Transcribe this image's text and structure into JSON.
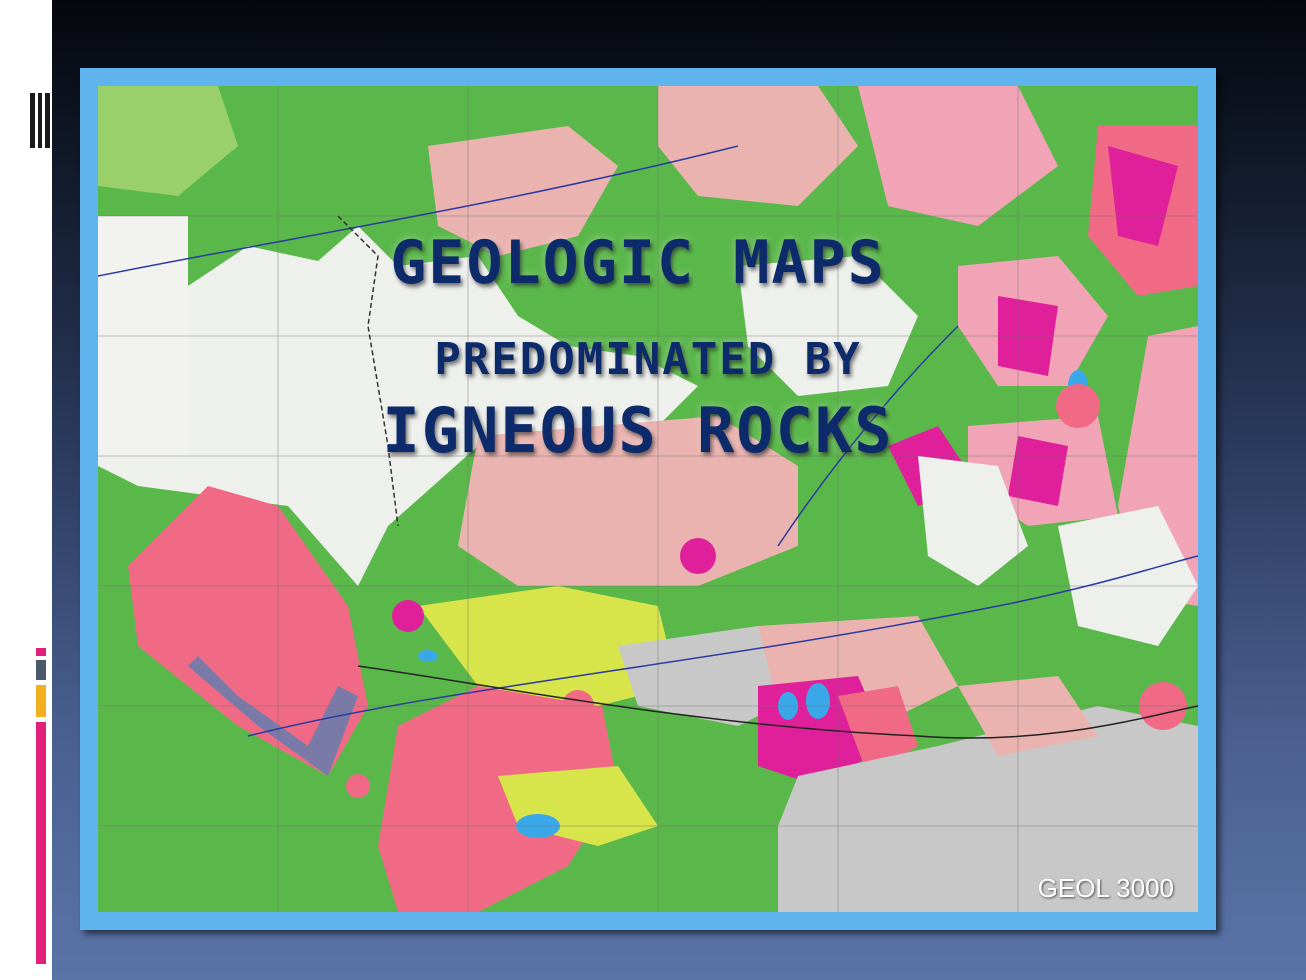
{
  "slide": {
    "title_line1": "GEOLOGIC MAPS",
    "title_line2": "PREDOMINATED BY",
    "title_line3": "IGNEOUS ROCKS",
    "footer": "GEOL 3000"
  },
  "colors": {
    "frame_border": "#5fb4ee",
    "title_text": "#0d2a6b",
    "side_accent_pink": "#e0207a",
    "side_accent_orange": "#f2b020",
    "side_accent_gray": "#4a5a6a"
  }
}
